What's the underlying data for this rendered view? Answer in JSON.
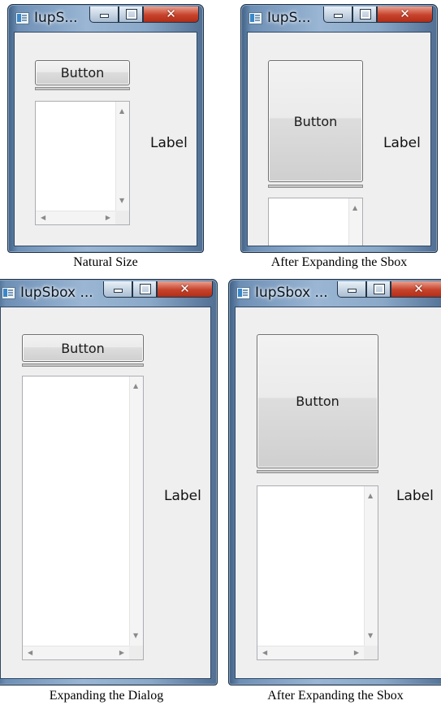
{
  "screenshots": [
    {
      "window_title": "IupS...",
      "button_label": "Button",
      "label_text": "Label",
      "caption": "Natural Size"
    },
    {
      "window_title": "IupS...",
      "button_label": "Button",
      "label_text": "Label",
      "caption": "After Expanding the Sbox"
    },
    {
      "window_title": "IupSbox ...",
      "button_label": "Button",
      "label_text": "Label",
      "caption": "Expanding the Dialog"
    },
    {
      "window_title": "IupSbox ...",
      "button_label": "Button",
      "label_text": "Label",
      "caption": "After Expanding the Sbox"
    }
  ],
  "controls": {
    "minimize": "minimize-icon",
    "maximize": "maximize-icon",
    "close": "close-icon"
  },
  "glyphs": {
    "close": "✕",
    "up": "▲",
    "down": "▼",
    "left": "◀",
    "right": "▶"
  }
}
